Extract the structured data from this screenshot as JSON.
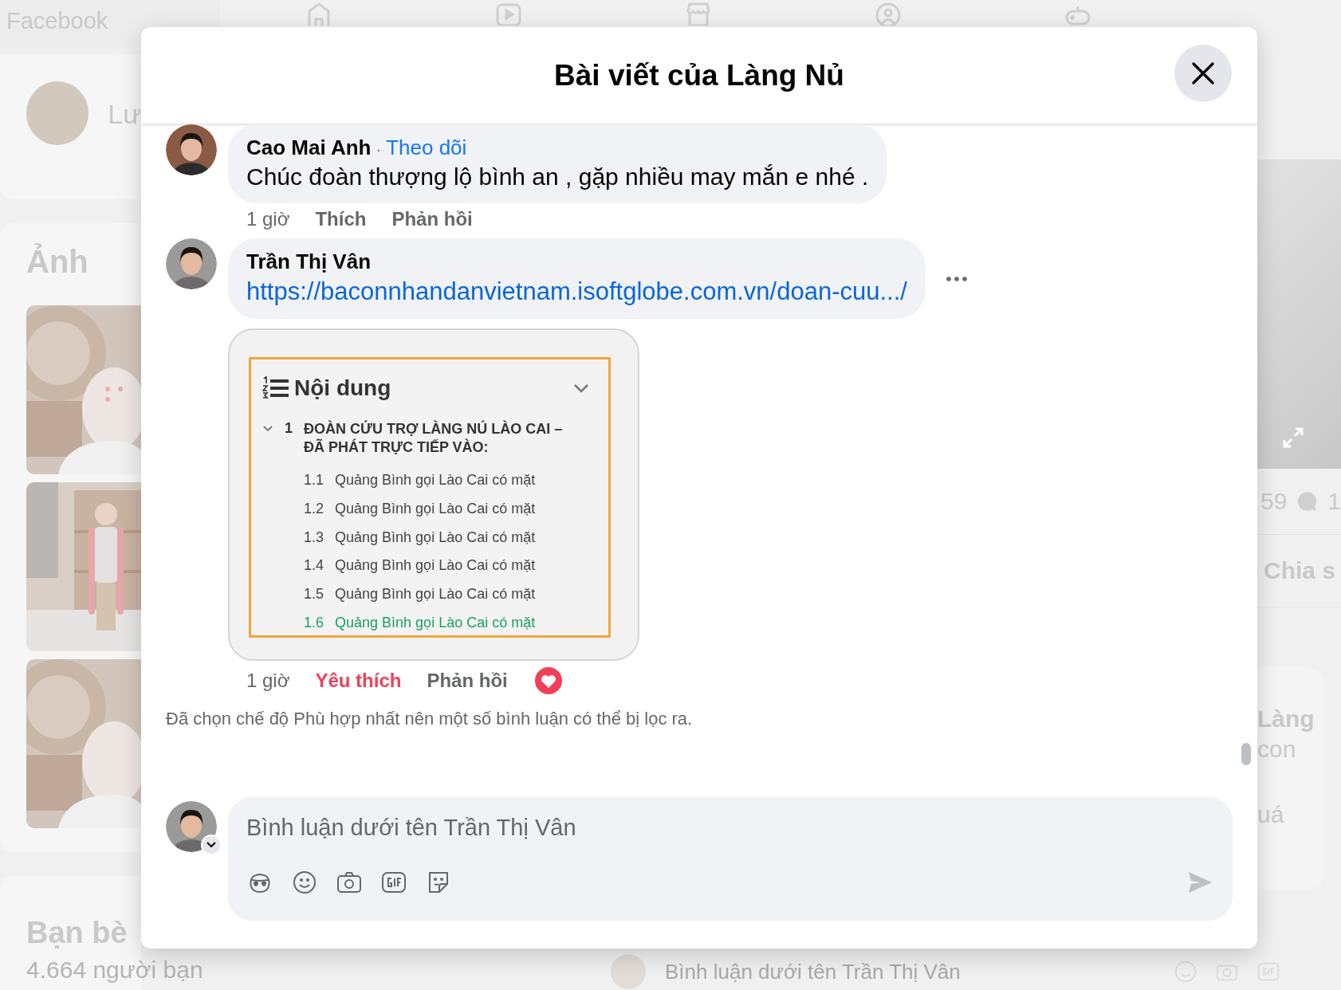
{
  "background": {
    "brand": "Facebook",
    "profile": {
      "name": "Lư"
    },
    "photos_section": {
      "title": "Ảnh"
    },
    "friends": {
      "title": "Bạn bè",
      "count": "4.664 người bạn"
    },
    "post": {
      "reaction_count": "59",
      "comment_count": "1",
      "share_label": "Chia s",
      "comment_preview": [
        "Làng",
        "con",
        "uá"
      ]
    },
    "composer_placeholder": "Bình luận dưới tên Trần Thị Vân"
  },
  "dialog": {
    "title": "Bài viết của Làng Nủ",
    "comments": [
      {
        "author": "Cao Mai Anh",
        "separator": "·",
        "follow": "Theo dõi",
        "text": "Chúc đoàn thượng lộ bình an , gặp nhiều may mắn e nhé .",
        "time": "1 giờ",
        "like": "Thích",
        "liked": false,
        "reply": "Phản hồi",
        "menu_visible": false
      },
      {
        "author": "Trần Thị Vân",
        "link": "https://baconnhandanvietnam.isoftglobe.com.vn/doan-cuu.../",
        "preview": {
          "heading": "Nội dung",
          "sections": [
            {
              "number": "1",
              "title": "ĐOÀN CỨU TRỢ LÀNG NÚ LÀO CAI – ĐÃ PHÁT TRỰC TIẾP VÀO:",
              "expanded": true,
              "children": [
                {
                  "number": "1.1",
                  "title": "Quảng Bình gọi Lào Cai có mặt",
                  "selected": false
                },
                {
                  "number": "1.2",
                  "title": "Quảng Bình gọi Lào Cai có mặt",
                  "selected": false
                },
                {
                  "number": "1.3",
                  "title": "Quảng Bình gọi Lào Cai có mặt",
                  "selected": false
                },
                {
                  "number": "1.4",
                  "title": "Quảng Bình gọi Lào Cai có mặt",
                  "selected": false
                },
                {
                  "number": "1.5",
                  "title": "Quảng Bình gọi Lào Cai có mặt",
                  "selected": false
                },
                {
                  "number": "1.6",
                  "title": "Quảng Bình gọi Lào Cai có mặt",
                  "selected": true
                }
              ]
            }
          ]
        },
        "time": "1 giờ",
        "like": "Yêu thích",
        "liked": true,
        "reply": "Phản hồi",
        "menu_visible": true
      }
    ],
    "filter_note": "Đã chọn chế độ Phù hợp nhất nên một số bình luận có thể bị lọc ra.",
    "composer": {
      "placeholder": "Bình luận dưới tên Trần Thị Vân"
    }
  }
}
